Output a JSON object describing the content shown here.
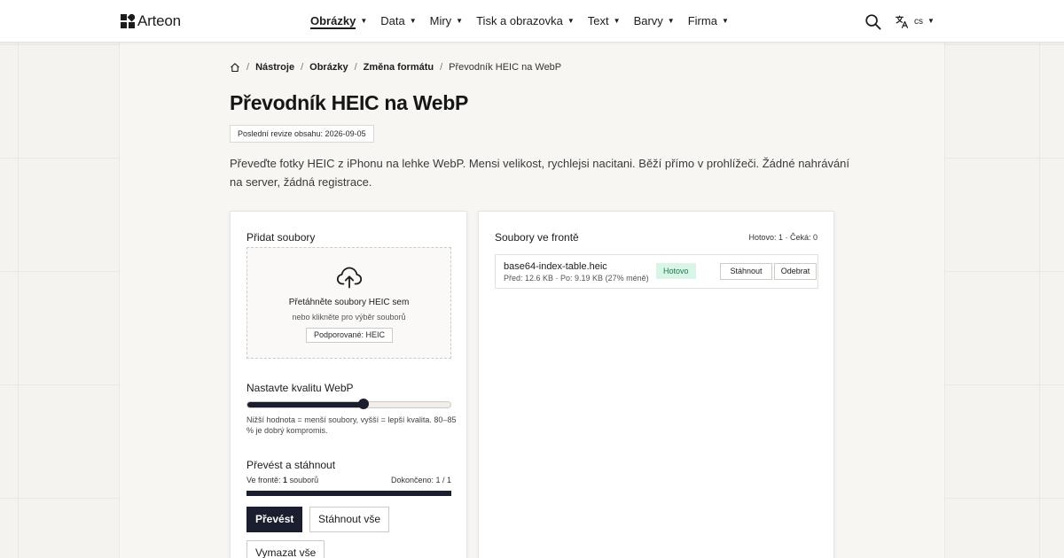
{
  "brand": {
    "name": "Arteon"
  },
  "nav": {
    "items": [
      {
        "label": "Obrázky",
        "active": true
      },
      {
        "label": "Data"
      },
      {
        "label": "Miry"
      },
      {
        "label": "Tisk a obrazovka"
      },
      {
        "label": "Text"
      },
      {
        "label": "Barvy"
      },
      {
        "label": "Firma"
      }
    ],
    "language": "cs",
    "icons": {
      "search": "search-icon",
      "language": "translate-icon",
      "dropdown": "caret-down-icon"
    }
  },
  "breadcrumb": {
    "items": [
      "Nástroje",
      "Obrázky",
      "Změna formátu"
    ],
    "current": "Převodník HEIC na WebP",
    "separator": "/"
  },
  "page": {
    "title": "Převodník HEIC na WebP",
    "revision": "Poslední revize obsahu: 2026-09-05",
    "intro": "Převeďte fotky HEIC z iPhonu na lehke WebP. Mensi velikost, rychlejsi nacitani. Běží přímo v prohlížeči. Žádné nahrávání na server, žádná registrace."
  },
  "upload": {
    "title": "Přidat soubory",
    "drop_title": "Přetáhněte soubory HEIC sem",
    "drop_sub": "nebo klikněte pro výběr souborů",
    "supported": "Podporované: HEIC",
    "icon": "cloud-upload-icon"
  },
  "quality": {
    "title": "Nastavte kvalitu WebP",
    "value": 0.57,
    "hint": "Nižší hodnota = menší soubory, vyšší = lepší kvalita. 80–85 % je dobrý kompromis."
  },
  "convert": {
    "title": "Převést a stáhnout",
    "queue_prefix": "Ve frontě:",
    "queue_count": "1",
    "queue_suffix": "souborů",
    "done": "Dokončeno: 1 / 1",
    "progress": 1.0,
    "convert_button": "Převést",
    "download_all_button": "Stáhnout vše",
    "clear_button": "Vymazat vše"
  },
  "queue": {
    "title": "Soubory ve frontě",
    "counts": "Hotovo: 1 · Čeká: 0",
    "files": [
      {
        "name": "base64-index-table.heic",
        "size": "Před: 12.6 KB · Po: 9.19 KB (27% méně)",
        "status": "Hotovo",
        "download": "Stáhnout",
        "remove": "Odebrat"
      }
    ]
  },
  "colors": {
    "accent": "#1b1e2e",
    "success_bg": "#d9f5e8",
    "success_text": "#187a4c",
    "page_bg": "#f5f3f0"
  }
}
